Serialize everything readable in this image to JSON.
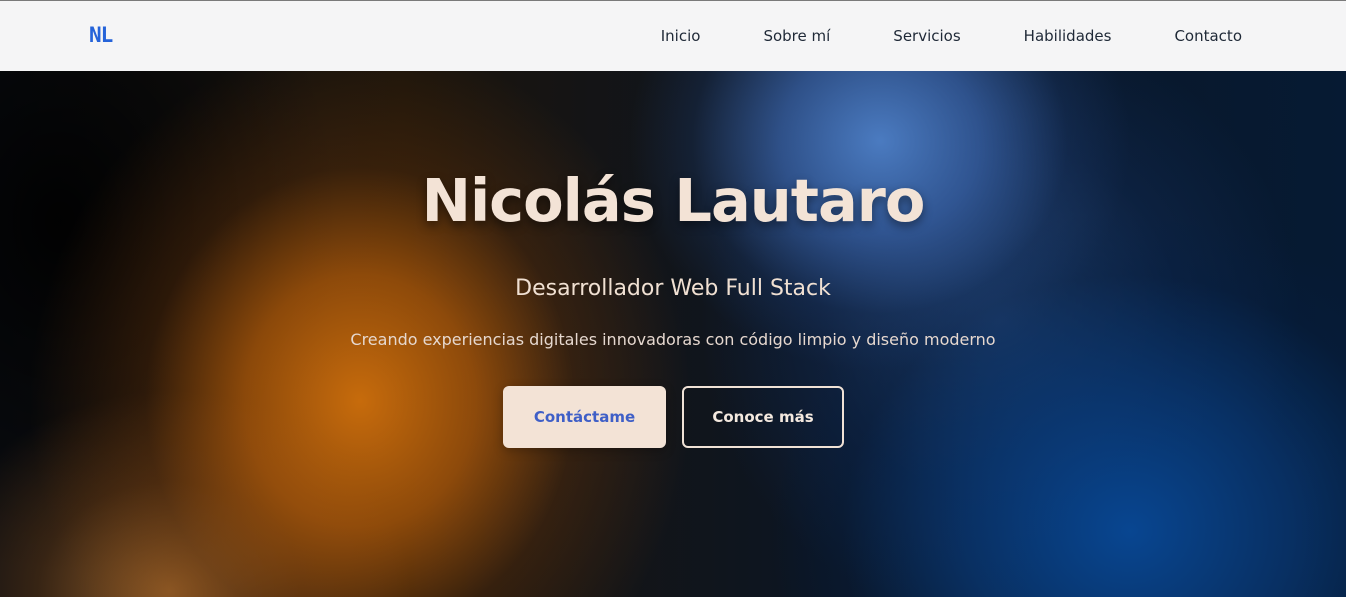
{
  "navbar": {
    "logo": "NL",
    "links": [
      {
        "label": "Inicio"
      },
      {
        "label": "Sobre mí"
      },
      {
        "label": "Servicios"
      },
      {
        "label": "Habilidades"
      },
      {
        "label": "Contacto"
      }
    ]
  },
  "hero": {
    "title": "Nicolás Lautaro",
    "subtitle": "Desarrollador Web Full Stack",
    "tagline": "Creando experiencias digitales innovadoras con código limpio y diseño moderno",
    "primary_button": "Contáctame",
    "secondary_button": "Conoce más"
  },
  "colors": {
    "accent": "#2563d9",
    "nav_background": "#f5f5f6",
    "hero_orange": "#d0700c",
    "hero_blue": "#4e80c8",
    "hero_deep_blue": "#084896",
    "button_light": "#f3e3d6"
  }
}
